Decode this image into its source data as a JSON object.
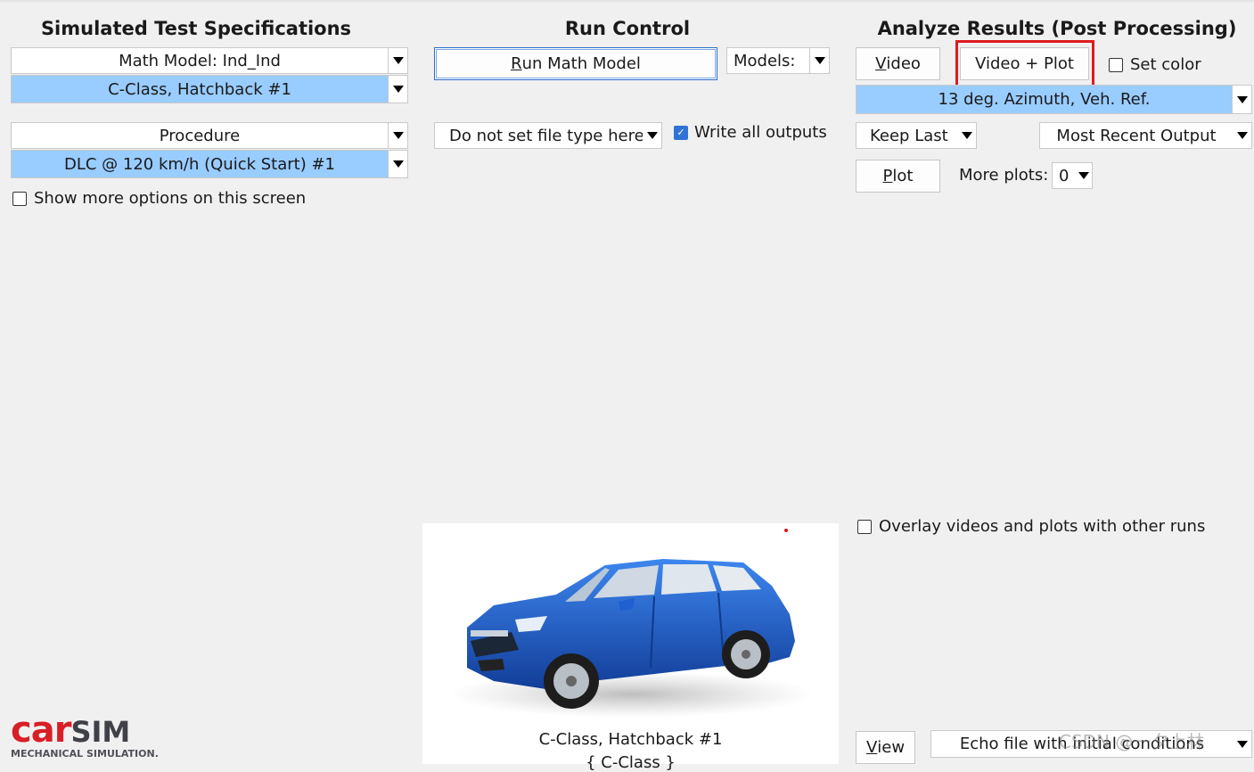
{
  "sections": {
    "specs_title": "Simulated Test Specifications",
    "run_title": "Run Control",
    "analyze_title": "Analyze Results (Post Processing)"
  },
  "specs": {
    "math_model": "Math Model: Ind_Ind",
    "vehicle": "C-Class, Hatchback #1",
    "procedure_label": "Procedure",
    "procedure": "DLC @ 120 km/h (Quick Start) #1",
    "show_more": "Show more options on this screen"
  },
  "run": {
    "run_button_u": "R",
    "run_button_rest": "un Math Model",
    "models": "Models:",
    "file_type": "Do not set file type here",
    "write_all": "Write all outputs"
  },
  "analyze": {
    "video_u": "V",
    "video_rest": "ideo",
    "video_plot": "Video + Plot",
    "set_color": "Set color",
    "view_option": "13 deg. Azimuth, Veh. Ref.",
    "keep_last": "Keep Last",
    "recent_output": "Most Recent Output",
    "plot_u": "P",
    "plot_rest": "lot",
    "more_plots_label": "More plots:",
    "more_plots_value": "0",
    "overlay": "Overlay videos and plots with other runs",
    "view_u": "V",
    "view_rest": "iew",
    "echo_file": "Echo file with initial conditions",
    "watermark": "CSDN @一夕上林"
  },
  "vehicle_panel": {
    "caption": "C-Class, Hatchback #1",
    "caption2": "{ C-Class }"
  },
  "logo": {
    "brand_car": "car",
    "brand_sim": "SIM",
    "tagline": "MECHANICAL SIMULATION."
  },
  "colors": {
    "selection": "#99ccff",
    "highlight_box": "#e0191f",
    "logo_red": "#d81f26",
    "car_blue": "#1f5fcf"
  }
}
